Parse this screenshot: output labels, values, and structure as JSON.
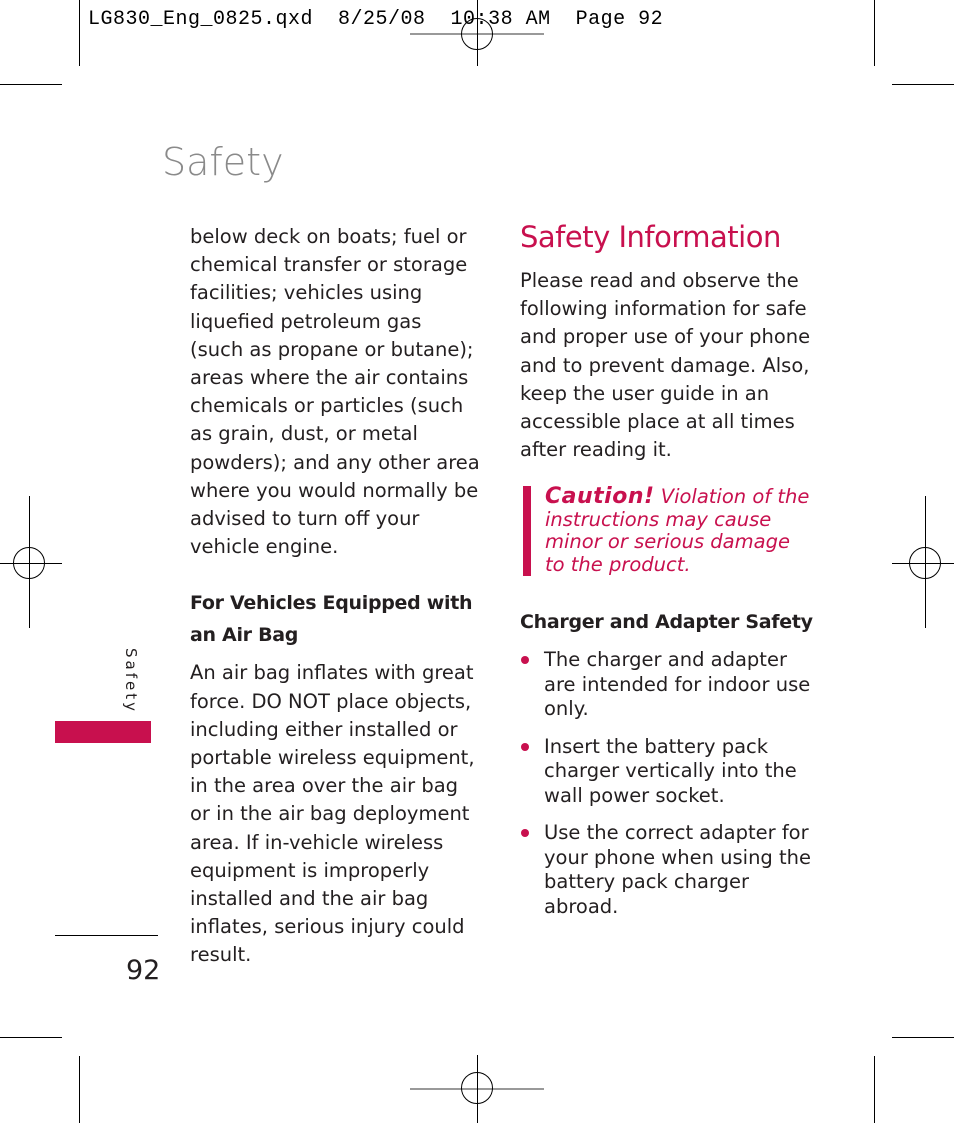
{
  "slug": "LG830_Eng_0825.qxd  8/25/08  10:38 AM  Page 92",
  "page_title": "Safety",
  "side_label": "Safety",
  "page_number": "92",
  "accent_color": "#c8104e",
  "left_column": {
    "intro": "below deck on boats; fuel or chemical transfer or storage facilities; vehicles using liquefied petroleum gas (such as propane or butane); areas where the air contains chemicals or particles (such as grain, dust, or metal powders); and any other area where you would normally be advised to turn off your vehicle engine.",
    "heading": "For Vehicles Equipped with an Air Bag",
    "body": "An air bag inflates with great force. DO NOT place objects, including either installed or portable wireless equipment, in the area over the air bag or in the air bag deployment area. If in-vehicle wireless equipment is improperly installed and the air bag inflates, serious injury could result."
  },
  "right_column": {
    "section_title": "Safety Information",
    "intro": "Please read and observe the following information for safe and proper use of your phone and to prevent damage. Also, keep the user guide in an accessible place at all times after reading it.",
    "caution_label": "Caution!",
    "caution_text": "Violation of the instructions may cause minor or serious damage to the product.",
    "heading": "Charger and Adapter Safety",
    "bullets": [
      "The charger and adapter are intended for indoor use only.",
      "Insert the battery pack charger vertically into the wall power socket.",
      "Use the correct adapter for your phone when using the battery pack charger abroad."
    ]
  }
}
